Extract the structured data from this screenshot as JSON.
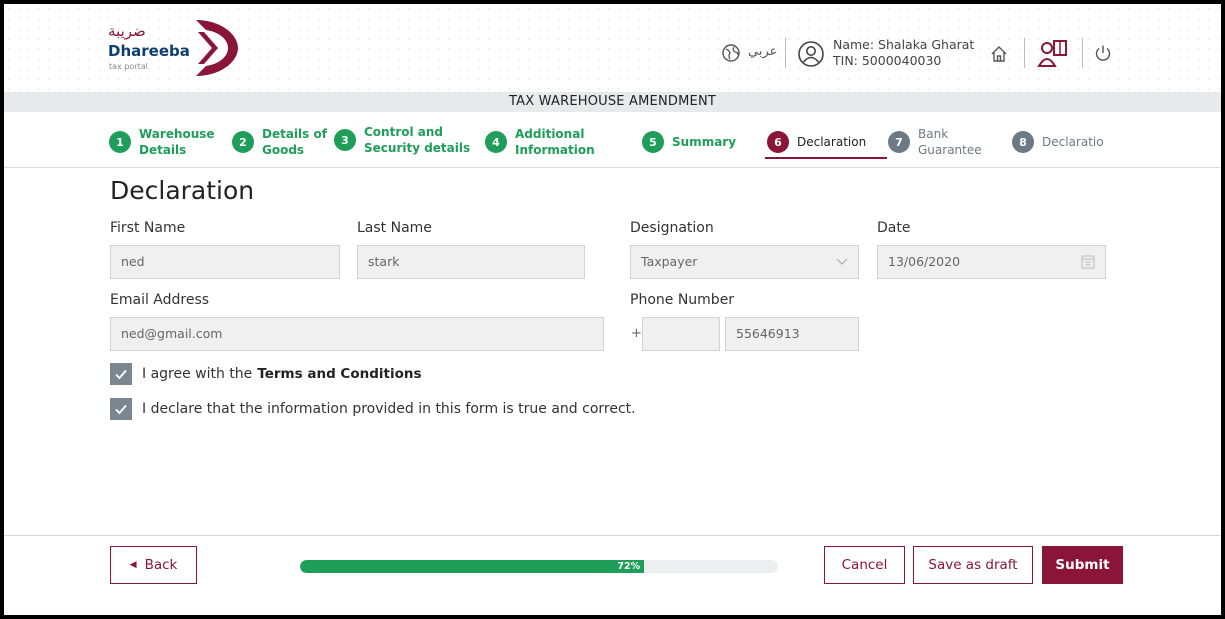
{
  "header": {
    "logo_arabic": "ضريبة",
    "logo_name": "Dhareeba",
    "logo_sub": "tax portal",
    "language_label": "عربي",
    "user_name": "Name: Shalaka Gharat",
    "user_tin": "TIN: 5000040030",
    "icons": [
      "globe-icon",
      "user-icon",
      "home-icon",
      "book-user-icon",
      "power-icon"
    ]
  },
  "title": "TAX WAREHOUSE AMENDMENT",
  "steps": [
    {
      "num": "1",
      "line1": "Warehouse",
      "line2": "Details",
      "state": "done"
    },
    {
      "num": "2",
      "line1": "Details of",
      "line2": "Goods",
      "state": "done"
    },
    {
      "num": "3",
      "line1": "Control and",
      "line2": "Security details",
      "state": "done"
    },
    {
      "num": "4",
      "line1": "Additional",
      "line2": "Information",
      "state": "done"
    },
    {
      "num": "5",
      "line1": "Summary",
      "line2": "",
      "state": "done"
    },
    {
      "num": "6",
      "line1": "Declaration",
      "line2": "",
      "state": "active"
    },
    {
      "num": "7",
      "line1": "Bank",
      "line2": "Guarantee",
      "state": "todo"
    },
    {
      "num": "8",
      "line1": "Declaratio",
      "line2": "",
      "state": "todo"
    }
  ],
  "form": {
    "heading": "Declaration",
    "first_name_label": "First Name",
    "first_name_value": "ned",
    "last_name_label": "Last Name",
    "last_name_value": "stark",
    "designation_label": "Designation",
    "designation_value": "Taxpayer",
    "date_label": "Date",
    "date_value": "13/06/2020",
    "email_label": "Email Address",
    "email_value": "ned@gmail.com",
    "phone_label": "Phone Number",
    "phone_prefix": "+",
    "phone_code": "",
    "phone_value": "55646913",
    "agree_text": "I agree with the",
    "terms_link": "Terms and Conditions",
    "declare_text": "I declare that the information provided in this form is true and correct.",
    "agree_checked": true,
    "declare_checked": true
  },
  "footer": {
    "back_label": "Back",
    "progress_percent": 72,
    "progress_label": "72%",
    "cancel_label": "Cancel",
    "draft_label": "Save as draft",
    "submit_label": "Submit"
  },
  "colors": {
    "brand": "#8a1538",
    "success": "#1e9e59",
    "muted_step": "#6c7a86"
  }
}
